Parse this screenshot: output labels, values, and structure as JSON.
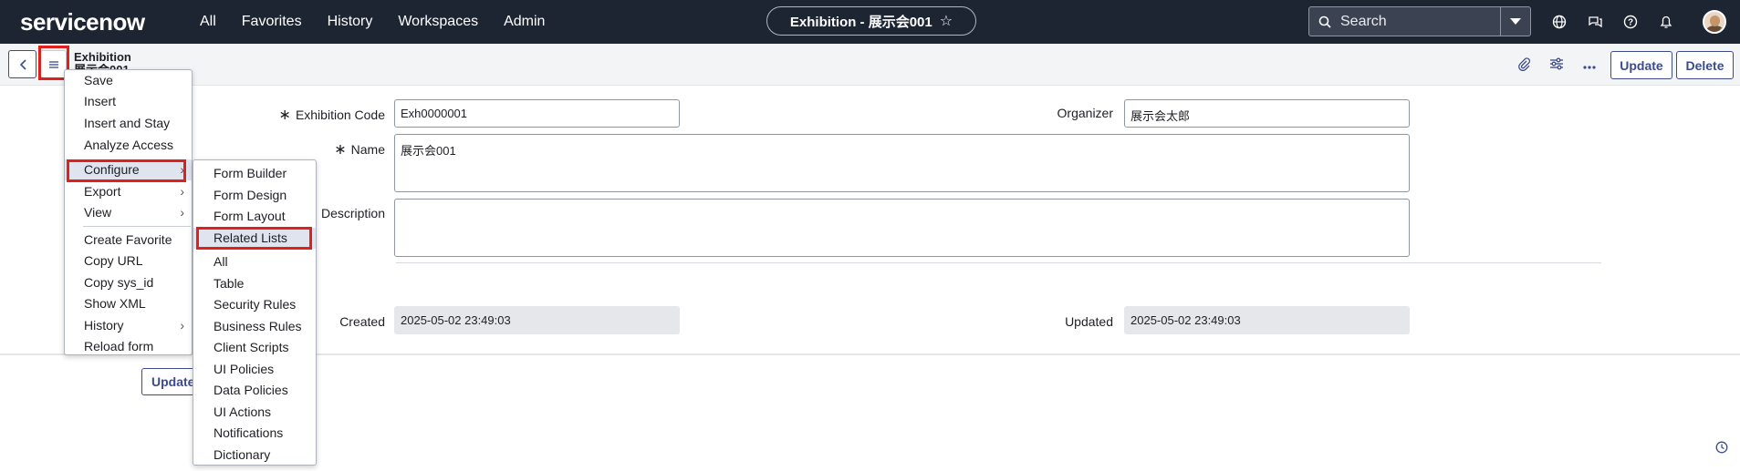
{
  "topbar": {
    "logo": "servicenow",
    "nav": [
      "All",
      "Favorites",
      "History",
      "Workspaces",
      "Admin"
    ],
    "record_pill": "Exhibition - 展示会001",
    "search_placeholder": "Search"
  },
  "header": {
    "title": "Exhibition",
    "subtitle": "展示会001",
    "update_label": "Update",
    "delete_label": "Delete"
  },
  "form": {
    "exhibition_code": {
      "label": "Exhibition Code",
      "value": "Exh0000001"
    },
    "organizer": {
      "label": "Organizer",
      "value": "展示会太郎"
    },
    "name": {
      "label": "Name",
      "value": "展示会001"
    },
    "description": {
      "label": "Description",
      "value": ""
    },
    "created": {
      "label": "Created",
      "value": "2025-05-02 23:49:03"
    },
    "updated": {
      "label": "Updated",
      "value": "2025-05-02 23:49:03"
    },
    "bottom_update_label": "Update"
  },
  "context_menu": {
    "items": [
      "Save",
      "Insert",
      "Insert and Stay",
      "Analyze Access",
      "Configure",
      "Export",
      "View",
      "Create Favorite",
      "Copy URL",
      "Copy sys_id",
      "Show XML",
      "History",
      "Reload form"
    ]
  },
  "submenu": {
    "items": [
      "Form Builder",
      "Form Design",
      "Form Layout",
      "Related Lists",
      "All",
      "Table",
      "Security Rules",
      "Business Rules",
      "Client Scripts",
      "UI Policies",
      "Data Policies",
      "UI Actions",
      "Notifications",
      "Dictionary"
    ]
  },
  "colors": {
    "topbar_bg": "#1d2432",
    "accent": "#3c4b8f",
    "highlight_outline": "#e0211b"
  }
}
